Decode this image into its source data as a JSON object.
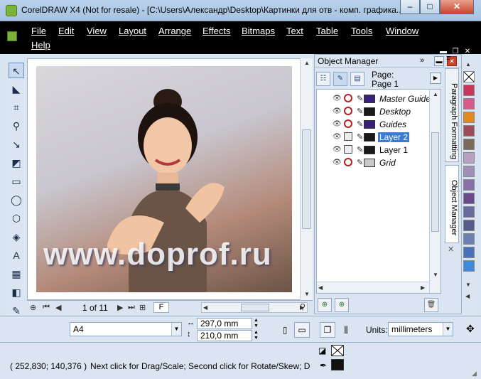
{
  "window": {
    "title": "CorelDRAW X4 (Not for resale) - [C:\\Users\\Александр\\Desktop\\Картинки для отв - комп. графика...",
    "min_label": "–",
    "max_label": "□",
    "close_label": "✕"
  },
  "menu": {
    "items": [
      "File",
      "Edit",
      "View",
      "Layout",
      "Arrange",
      "Effects",
      "Bitmaps",
      "Text",
      "Table",
      "Tools",
      "Window",
      "Help"
    ]
  },
  "canvas": {
    "watermark": "www.doprof.ru"
  },
  "pager": {
    "page_text": "1 of 11",
    "tab_label": "F"
  },
  "object_manager": {
    "title": "Object Manager",
    "page_label": "Page:",
    "page_value": "Page 1",
    "layers": [
      {
        "name": "Master Guides",
        "italic": true,
        "color": "#3a1f7a",
        "selected": false,
        "printable": false
      },
      {
        "name": "Desktop",
        "italic": true,
        "color": "#1a1a1a",
        "selected": false,
        "printable": false
      },
      {
        "name": "Guides",
        "italic": true,
        "color": "#3a1f7a",
        "selected": false,
        "printable": false
      },
      {
        "name": "Layer 2",
        "italic": false,
        "color": "#1a1a1a",
        "selected": true,
        "printable": true
      },
      {
        "name": "Layer 1",
        "italic": false,
        "color": "#1a1a1a",
        "selected": false,
        "printable": true
      },
      {
        "name": "Grid",
        "italic": true,
        "color": "#c8c8c8",
        "selected": false,
        "printable": false
      }
    ]
  },
  "side_tabs": {
    "paragraph_formatting": "Paragraph Formatting",
    "object_manager": "Object Manager"
  },
  "palette": {
    "colors": [
      "#ffffff",
      "#c8365a",
      "#d85a8a",
      "#e08a20",
      "#9a4a5a",
      "#7a6a5a",
      "#b8a0c0",
      "#a090b8",
      "#8a70a8",
      "#6a4a8a",
      "#6a6aa0",
      "#5a5a8a",
      "#6a80b0",
      "#4a70b8",
      "#3a8ae0"
    ]
  },
  "property_bar": {
    "paper_size": "A4",
    "width": "297,0 mm",
    "height": "210,0 mm",
    "units_label": "Units:",
    "units_value": "millimeters"
  },
  "status": {
    "coords": "( 252,830; 140,376 )",
    "message": "Next click for Drag/Scale; Second click for Rotate/Skew; Dbl-cli..."
  }
}
